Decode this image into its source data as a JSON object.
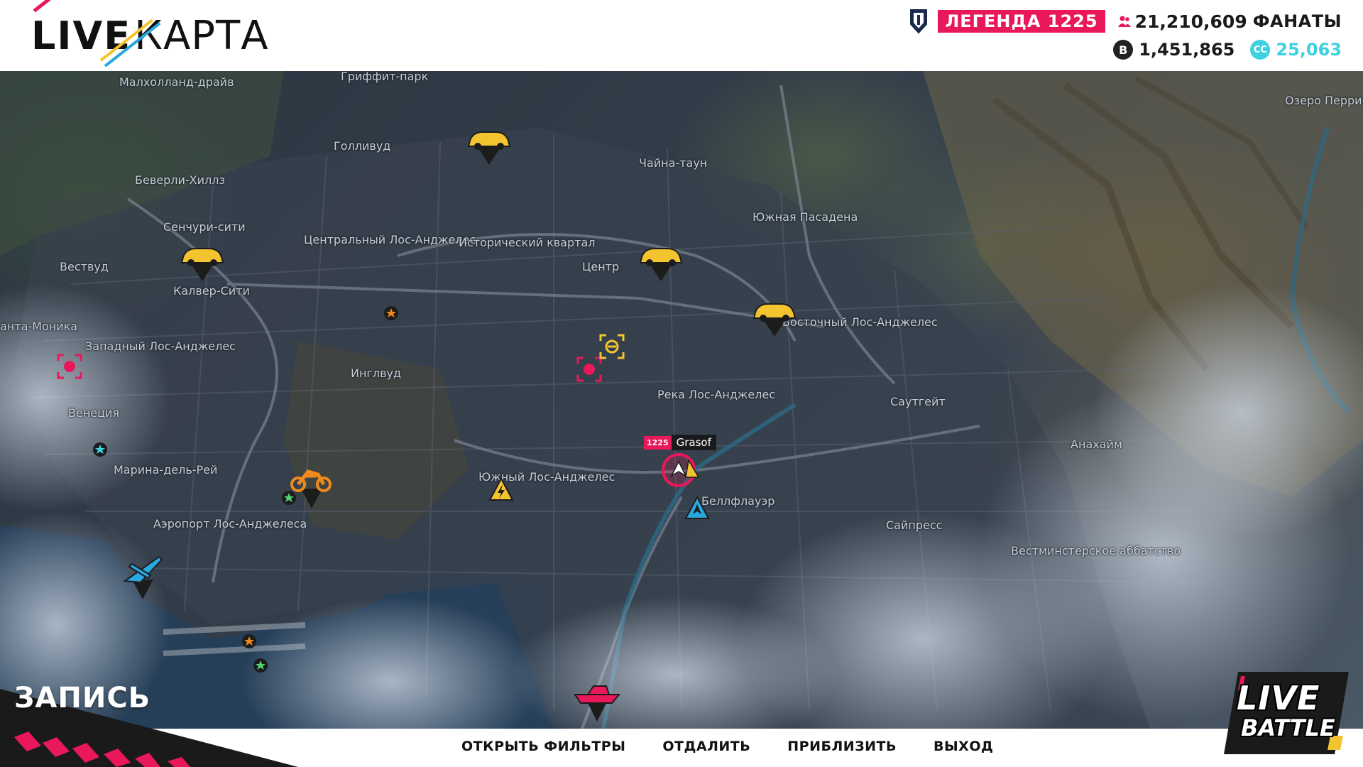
{
  "header": {
    "logo_live": "LIVE",
    "title": "КАРТА"
  },
  "stats": {
    "rank_label": "ЛЕГЕНДА",
    "rank_level": "1225",
    "fans_value": "21,210,609",
    "fans_label": "ФАНАТЫ",
    "bucks_symbol": "B",
    "bucks_value": "1,451,865",
    "crew_symbol": "CC",
    "crew_value": "25,063"
  },
  "map": {
    "places": [
      "Малхолланд-драйв",
      "Гриффит-парк",
      "Голливуд",
      "Чайна-таун",
      "Озеро Перрис",
      "Беверли-Хиллз",
      "Сенчури-сити",
      "Центральный Лос-Анджелес",
      "Исторический квартал",
      "Южная Пасадена",
      "Вествуд",
      "Центр",
      "Калвер-Сити",
      "Восточный Лос-Анджелес",
      "анта-Моника",
      "Западный Лос-Анджелес",
      "Инглвуд",
      "Река Лос-Анджелес",
      "Саутгейт",
      "Венеция",
      "Анахайм",
      "Марина-дель-Рей",
      "Южный Лос-Анджелес",
      "Беллфлауэр",
      "Аэропорт Лос-Анджелеса",
      "Сайпресс",
      "Вестминстерское аббатство"
    ],
    "player": {
      "level": "1225",
      "name": "Grasof"
    }
  },
  "bottom": {
    "recording_label": "ЗАПИСЬ",
    "actions": [
      "ОТКРЫТЬ ФИЛЬТРЫ",
      "ОТДАЛИТЬ",
      "ПРИБЛИЗИТЬ",
      "ВЫХОД"
    ]
  },
  "badge": {
    "line1": "LIVE",
    "line2": "BATTLE"
  },
  "colors": {
    "accent": "#e8185b",
    "cc": "#3dd1e0",
    "marker_yellow": "#f4c430",
    "marker_orange": "#f08a1c",
    "marker_blue": "#2aa7de"
  }
}
